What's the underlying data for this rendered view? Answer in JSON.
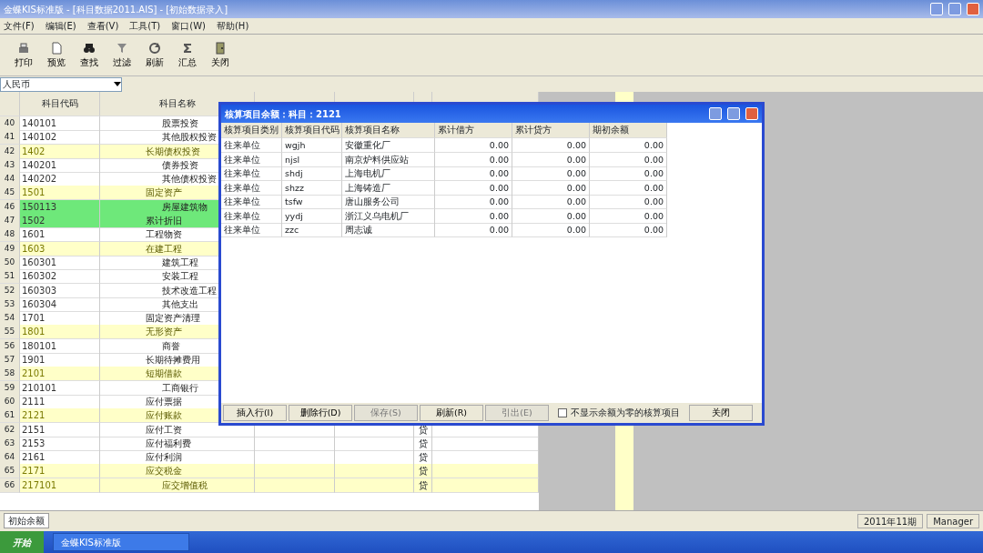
{
  "window": {
    "title": "金蝶KIS标准版 - [科目数据2011.AIS] - [初始数据录入]"
  },
  "menu": [
    "文件(F)",
    "编辑(E)",
    "查看(V)",
    "工具(T)",
    "窗口(W)",
    "帮助(H)"
  ],
  "toolbar": [
    {
      "label": "打印",
      "kind": "printer"
    },
    {
      "label": "预览",
      "kind": "page"
    },
    {
      "label": "查找",
      "kind": "binoculars"
    },
    {
      "label": "过滤",
      "kind": "funnel"
    },
    {
      "label": "刷新",
      "kind": "refresh"
    },
    {
      "label": "汇总",
      "kind": "sum"
    },
    {
      "label": "关闭",
      "kind": "door"
    }
  ],
  "currency": {
    "value": "人民币"
  },
  "grid": {
    "columns": [
      "科目代码",
      "科目名称"
    ],
    "rows": [
      {
        "no": "40",
        "code": "140101",
        "name": "股票投资",
        "kind": "sub",
        "highlighted": false,
        "selected": false
      },
      {
        "no": "41",
        "code": "140102",
        "name": "其他股权投资",
        "kind": "sub",
        "highlighted": false,
        "selected": false
      },
      {
        "no": "42",
        "code": "1402",
        "name": "长期债权投资",
        "kind": "main",
        "highlighted": true,
        "selected": false
      },
      {
        "no": "43",
        "code": "140201",
        "name": "债券投资",
        "kind": "sub",
        "highlighted": false,
        "selected": false
      },
      {
        "no": "44",
        "code": "140202",
        "name": "其他债权投资",
        "kind": "sub",
        "highlighted": false,
        "selected": false
      },
      {
        "no": "45",
        "code": "1501",
        "name": "固定资产",
        "kind": "main",
        "highlighted": true,
        "selected": false
      },
      {
        "no": "46",
        "code": "150113",
        "name": "房屋建筑物",
        "kind": "sub",
        "highlighted": false,
        "selected": true
      },
      {
        "no": "47",
        "code": "1502",
        "name": "累计折旧",
        "kind": "main",
        "highlighted": false,
        "selected": true
      },
      {
        "no": "48",
        "code": "1601",
        "name": "工程物资",
        "kind": "main",
        "highlighted": false,
        "selected": false
      },
      {
        "no": "49",
        "code": "1603",
        "name": "在建工程",
        "kind": "main",
        "highlighted": true,
        "selected": false
      },
      {
        "no": "50",
        "code": "160301",
        "name": "建筑工程",
        "kind": "sub",
        "highlighted": false,
        "selected": false
      },
      {
        "no": "51",
        "code": "160302",
        "name": "安装工程",
        "kind": "sub",
        "highlighted": false,
        "selected": false
      },
      {
        "no": "52",
        "code": "160303",
        "name": "技术改造工程",
        "kind": "sub",
        "highlighted": false,
        "selected": false
      },
      {
        "no": "53",
        "code": "160304",
        "name": "其他支出",
        "kind": "sub",
        "highlighted": false,
        "selected": false
      },
      {
        "no": "54",
        "code": "1701",
        "name": "固定资产清理",
        "kind": "main",
        "highlighted": false,
        "selected": false
      },
      {
        "no": "55",
        "code": "1801",
        "name": "无形资产",
        "kind": "main",
        "highlighted": true,
        "selected": false
      },
      {
        "no": "56",
        "code": "180101",
        "name": "商誉",
        "kind": "sub",
        "highlighted": false,
        "selected": false
      },
      {
        "no": "57",
        "code": "1901",
        "name": "长期待摊费用",
        "kind": "main",
        "highlighted": false,
        "selected": false
      },
      {
        "no": "58",
        "code": "2101",
        "name": "短期借款",
        "kind": "main",
        "highlighted": true,
        "selected": false
      },
      {
        "no": "59",
        "code": "210101",
        "name": "工商银行",
        "kind": "sub",
        "highlighted": false,
        "selected": false
      },
      {
        "no": "60",
        "code": "2111",
        "name": "应付票据",
        "kind": "main",
        "highlighted": false,
        "selected": false
      },
      {
        "no": "61",
        "code": "2121",
        "name": "应付账款",
        "kind": "main",
        "highlighted": true,
        "selected": false
      },
      {
        "no": "62",
        "code": "2151",
        "name": "应付工资",
        "kind": "main",
        "highlighted": false,
        "selected": false,
        "direction": "贷"
      },
      {
        "no": "63",
        "code": "2153",
        "name": "应付福利费",
        "kind": "main",
        "highlighted": false,
        "selected": false,
        "direction": "贷"
      },
      {
        "no": "64",
        "code": "2161",
        "name": "应付利润",
        "kind": "main",
        "highlighted": false,
        "selected": false,
        "direction": "贷"
      },
      {
        "no": "65",
        "code": "2171",
        "name": "应交税金",
        "kind": "main",
        "highlighted": true,
        "selected": false,
        "direction": "贷"
      },
      {
        "no": "66",
        "code": "217101",
        "name": "应交增值税",
        "kind": "sub",
        "highlighted": true,
        "selected": false,
        "direction": "贷"
      }
    ]
  },
  "sheet_tab": "初始余额",
  "dialog": {
    "title": "核算项目余额：科目：2121",
    "columns": [
      "核算项目类别",
      "核算项目代码",
      "核算项目名称",
      "累计借方",
      "累计贷方",
      "期初余额"
    ],
    "rows": [
      [
        "往来单位",
        "wgjh",
        "安徽重化厂",
        "0.00",
        "0.00",
        "0.00"
      ],
      [
        "往来单位",
        "njsl",
        "南京炉料供应站",
        "0.00",
        "0.00",
        "0.00"
      ],
      [
        "往来单位",
        "shdj",
        "上海电机厂",
        "0.00",
        "0.00",
        "0.00"
      ],
      [
        "往来单位",
        "shzz",
        "上海铸造厂",
        "0.00",
        "0.00",
        "0.00"
      ],
      [
        "往来单位",
        "tsfw",
        "唐山服务公司",
        "0.00",
        "0.00",
        "0.00"
      ],
      [
        "往来单位",
        "yydj",
        "浙江义乌电机厂",
        "0.00",
        "0.00",
        "0.00"
      ],
      [
        "往来单位",
        "zzc",
        "周志诚",
        "0.00",
        "0.00",
        "0.00"
      ]
    ],
    "buttons": [
      {
        "label": "插入行(I)",
        "disabled": false
      },
      {
        "label": "删除行(D)",
        "disabled": false
      },
      {
        "label": "保存(S)",
        "disabled": true
      },
      {
        "label": "刷新(R)",
        "disabled": false
      },
      {
        "label": "引出(E)",
        "disabled": true
      }
    ],
    "hide_zero": {
      "label": "不显示余额为零的核算项目",
      "checked": false
    },
    "close_button": "关闭"
  },
  "status_bar": {
    "period": "2011年11期",
    "user": "Manager"
  },
  "taskbar": {
    "start": "开始",
    "task": "金蝶KIS标准版"
  }
}
